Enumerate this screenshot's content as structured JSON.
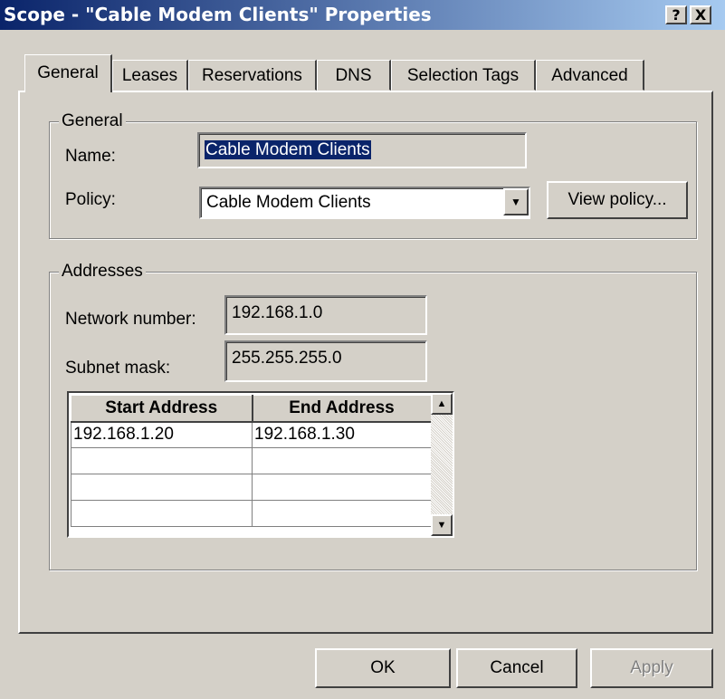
{
  "window": {
    "title": "Scope - \"Cable Modem Clients\" Properties",
    "help_btn": "?",
    "close_btn": "X"
  },
  "tabs": [
    "General",
    "Leases",
    "Reservations",
    "DNS",
    "Selection Tags",
    "Advanced"
  ],
  "general_group": {
    "legend": "General",
    "name_label": "Name:",
    "name_value": "Cable Modem Clients",
    "policy_label": "Policy:",
    "policy_value": "Cable Modem Clients",
    "view_policy_button": "View policy..."
  },
  "addresses_group": {
    "legend": "Addresses",
    "network_label": "Network number:",
    "network_value": "192.168.1.0",
    "subnet_label": "Subnet mask:",
    "subnet_value": "255.255.255.0",
    "columns": [
      "Start Address",
      "End Address"
    ],
    "rows": [
      [
        "192.168.1.20",
        "192.168.1.30"
      ],
      [
        "",
        ""
      ],
      [
        "",
        ""
      ],
      [
        "",
        ""
      ]
    ]
  },
  "buttons": {
    "ok": "OK",
    "cancel": "Cancel",
    "apply": "Apply"
  },
  "icons": {
    "dropdown": "chevron-down-icon",
    "scroll_up": "arrow-up-icon",
    "scroll_down": "arrow-down-icon"
  },
  "colors": {
    "titlebar_start": "#0a246a",
    "titlebar_end": "#a6caf0",
    "dialog_bg": "#d4d0c8",
    "selection": "#0a246a"
  }
}
